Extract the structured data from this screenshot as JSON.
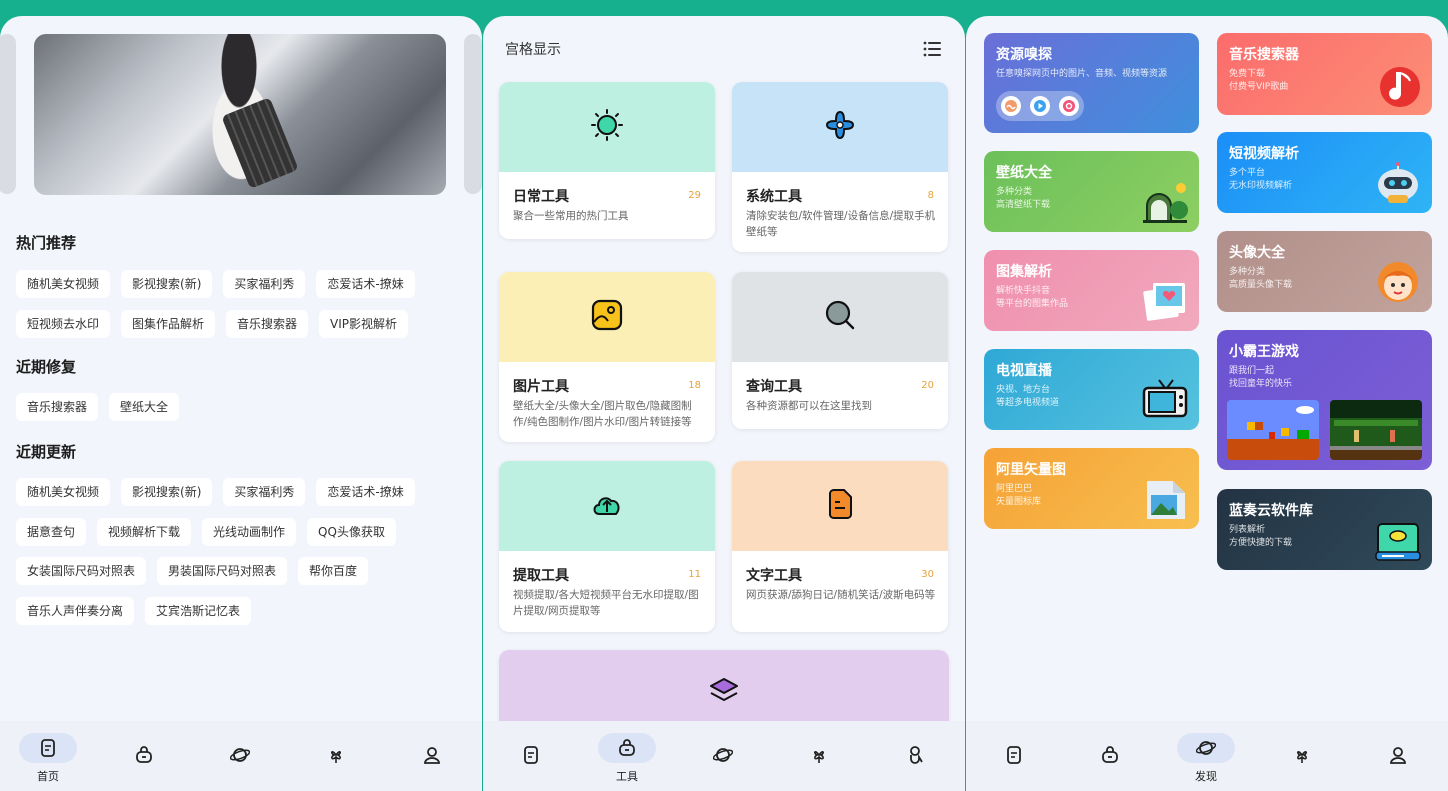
{
  "home": {
    "sections": [
      {
        "title": "热门推荐",
        "tags": [
          "随机美女视频",
          "影视搜索(新)",
          "买家福利秀",
          "恋爱话术-撩妹",
          "短视频去水印",
          "图集作品解析",
          "音乐搜索器",
          "VIP影视解析"
        ]
      },
      {
        "title": "近期修复",
        "tags": [
          "音乐搜索器",
          "壁纸大全"
        ]
      },
      {
        "title": "近期更新",
        "tags": [
          "随机美女视频",
          "影视搜索(新)",
          "买家福利秀",
          "恋爱话术-撩妹",
          "据意查句",
          "视频解析下载",
          "光线动画制作",
          "QQ头像获取",
          "女装国际尺码对照表",
          "男装国际尺码对照表",
          "帮你百度",
          "音乐人声伴奏分离",
          "艾宾浩斯记忆表"
        ]
      }
    ]
  },
  "tools": {
    "header": "宫格显示",
    "cards": [
      {
        "name": "日常工具",
        "count": "29",
        "desc": "聚合一些常用的热门工具",
        "color": "#bdf0e0"
      },
      {
        "name": "系统工具",
        "count": "8",
        "desc": "清除安装包/软件管理/设备信息/提取手机壁纸等",
        "color": "#c6e3f7"
      },
      {
        "name": "图片工具",
        "count": "18",
        "desc": "壁纸大全/头像大全/图片取色/隐藏图制作/纯色图制作/图片水印/图片转链接等",
        "color": "#fbefb6"
      },
      {
        "name": "查询工具",
        "count": "20",
        "desc": "各种资源都可以在这里找到",
        "color": "#dfe3e6"
      },
      {
        "name": "提取工具",
        "count": "11",
        "desc": "视频提取/各大短视频平台无水印提取/图片提取/网页提取等",
        "color": "#bdf0e0"
      },
      {
        "name": "文字工具",
        "count": "30",
        "desc": "网页获源/舔狗日记/随机笑话/波斯电码等",
        "color": "#fbdcbf"
      }
    ],
    "last_card_color": "#e3cdee"
  },
  "discover": {
    "left": [
      {
        "title": "资源嗅探",
        "sub": "任意嗅探网页中的图片、音频、视频等资源",
        "color1": "#6a6fd8",
        "color2": "#3f8fdc",
        "icon": "sniff-icon"
      },
      {
        "title": "壁纸大全",
        "sub": "多种分类\n高清壁纸下载",
        "color1": "#6cc05a",
        "color2": "#8dcf62",
        "icon": "wallpaper-icon"
      },
      {
        "title": "图集解析",
        "sub": "解析快手抖音\n等平台的图集作品",
        "color1": "#ef8fae",
        "color2": "#f1a9bd",
        "icon": "photo-icon"
      },
      {
        "title": "电视直播",
        "sub": "央视、地方台\n等超多电视频道",
        "color1": "#2fa8d6",
        "color2": "#56c3df",
        "icon": "tv-icon"
      },
      {
        "title": "阿里矢量图",
        "sub": "阿里巴巴\n矢量图标库",
        "color1": "#f6a236",
        "color2": "#f7bf4f",
        "icon": "vector-icon"
      }
    ],
    "right": [
      {
        "title": "音乐搜索器",
        "sub": "免费下载\n付费号VIP歌曲",
        "color1": "#fb6c6c",
        "color2": "#fc8e76",
        "icon": "music-icon"
      },
      {
        "title": "短视频解析",
        "sub": "多个平台\n无水印视频解析",
        "color1": "#1b8ef7",
        "color2": "#2fb4f5",
        "icon": "robot-icon"
      },
      {
        "title": "头像大全",
        "sub": "多种分类\n高质量头像下载",
        "color1": "#b18f8a",
        "color2": "#c2a39c",
        "icon": "avatar-icon"
      },
      {
        "title": "小霸王游戏",
        "sub": "跟我们一起\n找回童年的快乐",
        "color1": "#6a53d1",
        "color2": "#7c5fd6",
        "icon": "game-icon"
      },
      {
        "title": "蓝奏云软件库",
        "sub": "列表解析\n方便快捷的下载",
        "color1": "#233343",
        "color2": "#2f4a5a",
        "icon": "lanzou-icon"
      }
    ]
  },
  "nav": {
    "home": "首页",
    "tools": "工具",
    "discover": "发现"
  }
}
